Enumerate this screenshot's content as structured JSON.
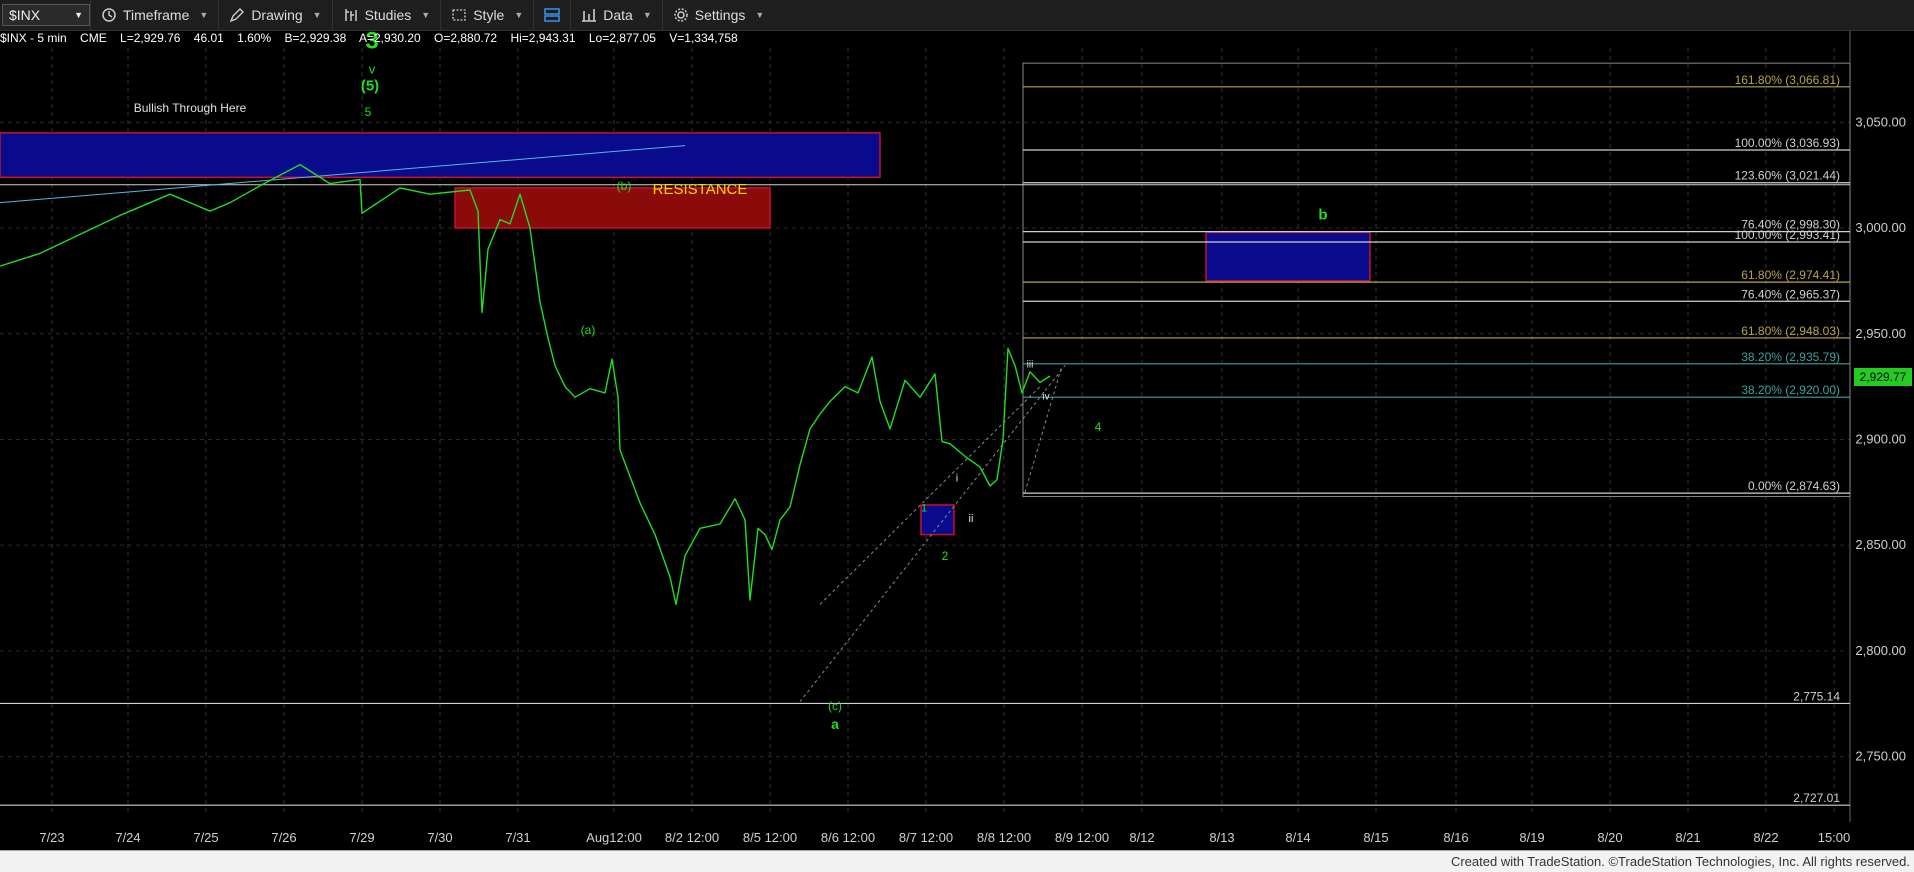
{
  "toolbar": {
    "symbol": "$INX",
    "timeframe": "Timeframe",
    "drawing": "Drawing",
    "studies": "Studies",
    "style": "Style",
    "data": "Data",
    "settings": "Settings"
  },
  "status": {
    "symbol_line": "$INX - 5 min",
    "exchange": "CME",
    "last": "L=2,929.76",
    "change": "46.01",
    "pct": "1.60%",
    "bid": "B=2,929.38",
    "ask": "A=2,930.20",
    "open": "O=2,880.72",
    "high": "Hi=2,943.31",
    "low": "Lo=2,877.05",
    "volume": "V=1,334,758"
  },
  "footer": "Created with TradeStation. ©TradeStation Technologies, Inc. All rights reserved.",
  "colors": {
    "price": "#22dd22",
    "background": "#000000",
    "grid": "#3a3a3a"
  },
  "chart_data": {
    "type": "line",
    "title": "",
    "ylim": [
      2720,
      3088
    ],
    "y_ticks": [
      "3,050.00",
      "3,000.00",
      "2,950.00",
      "2,900.00",
      "2,850.00",
      "2,800.00",
      "2,750.00"
    ],
    "x_labels": [
      "7/23",
      "7/24",
      "7/25",
      "7/26",
      "7/29",
      "7/30",
      "7/31",
      "Aug12:00",
      "8/2 12:00",
      "8/5 12:00",
      "8/6 12:00",
      "8/7 12:00",
      "8/8 12:00",
      "8/9 12:00",
      "8/12",
      "8/13",
      "8/14",
      "8/15",
      "8/16",
      "8/19",
      "8/20",
      "8/21",
      "8/22",
      "15:00"
    ],
    "last_price": "2,929.77",
    "series": [
      {
        "x": [
          0,
          40,
          80,
          120,
          170,
          210,
          230,
          260,
          300,
          330,
          360,
          362,
          400,
          430,
          470,
          478,
          482,
          488,
          500,
          510,
          520,
          530,
          540,
          548,
          555,
          565,
          575,
          590,
          605,
          612,
          618,
          620,
          640,
          655,
          670,
          676,
          685,
          700,
          720,
          735,
          745,
          750,
          758,
          765,
          772,
          780,
          790,
          800,
          810,
          820,
          830,
          845,
          858,
          872,
          880,
          890,
          905,
          920,
          935,
          942,
          950,
          965,
          980,
          990,
          997,
          1003,
          1008,
          1015,
          1022,
          1030,
          1040,
          1050
        ],
        "values": [
          2982,
          2988,
          2997,
          3006,
          3016,
          3008,
          3012,
          3020,
          3030,
          3021,
          3023,
          3007,
          3019,
          3016,
          3018,
          3008,
          2960,
          2990,
          3004,
          3002,
          3016,
          3000,
          2965,
          2948,
          2935,
          2925,
          2920,
          2924,
          2922,
          2938,
          2920,
          2895,
          2870,
          2855,
          2835,
          2822,
          2845,
          2858,
          2860,
          2872,
          2862,
          2824,
          2858,
          2855,
          2848,
          2862,
          2868,
          2888,
          2905,
          2912,
          2918,
          2925,
          2922,
          2939,
          2918,
          2905,
          2928,
          2920,
          2931,
          2899,
          2898,
          2892,
          2887,
          2878,
          2881,
          2900,
          2943,
          2935,
          2922,
          2932,
          2927,
          2930
        ]
      }
    ],
    "horizontal_levels": [
      {
        "label": "161.80% (3,066.81)",
        "value": 3066.81,
        "color": "#b8a44a"
      },
      {
        "label": "100.00% (3,036.93)",
        "value": 3036.93,
        "color": "#d0d0d0"
      },
      {
        "label": "123.60% (3,021.44)",
        "value": 3021.44,
        "color": "#d0d0d0"
      },
      {
        "label": "76.40% (2,998.30)",
        "value": 2998.3,
        "color": "#d0d0d0"
      },
      {
        "label": "100.00% (2,993.41)",
        "value": 2993.41,
        "color": "#d0d0d0"
      },
      {
        "label": "61.80% (2,974.41)",
        "value": 2974.41,
        "color": "#b8a44a"
      },
      {
        "label": "76.40% (2,965.37)",
        "value": 2965.37,
        "color": "#d0d0d0"
      },
      {
        "label": "61.80% (2,948.03)",
        "value": 2948.03,
        "color": "#b8a44a"
      },
      {
        "label": "38.20% (2,935.79)",
        "value": 2935.79,
        "color": "#3ea0a0"
      },
      {
        "label": "38.20% (2,920.00)",
        "value": 2920.0,
        "color": "#3ea0a0"
      },
      {
        "label": "0.00% (2,874.63)",
        "value": 2874.63,
        "color": "#d0d0d0"
      },
      {
        "label": "2,775.14",
        "value": 2775.14,
        "color": "#d0d0d0"
      },
      {
        "label": "2,727.01",
        "value": 2727.01,
        "color": "#d0d0d0"
      }
    ],
    "annotations": [
      {
        "text": "Bullish Through Here"
      },
      {
        "text": "RESISTANCE"
      },
      {
        "text": "3"
      },
      {
        "text": "v"
      },
      {
        "text": "(5)"
      },
      {
        "text": "5"
      },
      {
        "text": "(a)"
      },
      {
        "text": "(b)"
      },
      {
        "text": "(c)"
      },
      {
        "text": "a"
      },
      {
        "text": "1"
      },
      {
        "text": "2"
      },
      {
        "text": "i"
      },
      {
        "text": "ii"
      },
      {
        "text": "iii"
      },
      {
        "text": "iv"
      },
      {
        "text": "4"
      },
      {
        "text": "b"
      }
    ]
  }
}
